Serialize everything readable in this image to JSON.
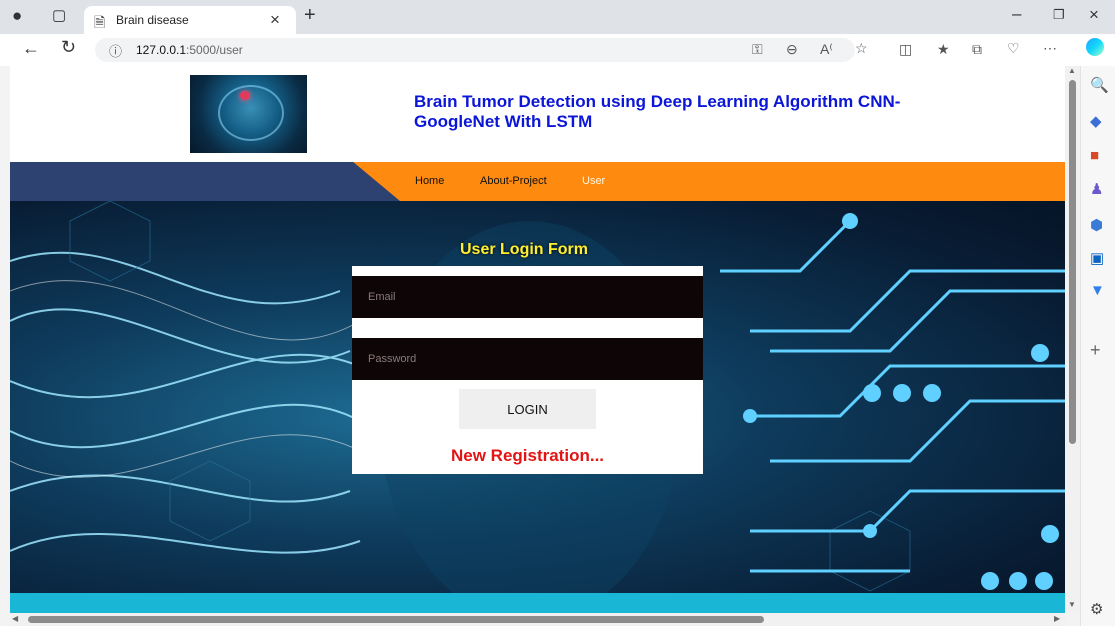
{
  "browser": {
    "tab_title": "Brain disease",
    "url_host": "127.0.0.1",
    "url_path": ":5000/user",
    "icons": [
      "profile-icon",
      "tab-actions-icon",
      "document-icon",
      "close-icon",
      "new-tab-icon",
      "minimize-icon",
      "restore-icon",
      "window-close-icon",
      "back-icon",
      "refresh-icon",
      "info-icon",
      "key-icon",
      "zoom-icon",
      "read-aloud-icon",
      "favorite-icon",
      "split-screen-icon",
      "favorites-icon",
      "collections-icon",
      "health-icon",
      "more-icon",
      "copilot-icon"
    ]
  },
  "sidebar": {
    "icons": [
      "search-icon",
      "shopping-tag-icon",
      "briefcase-icon",
      "games-icon",
      "office-icon",
      "outlook-icon",
      "send-icon",
      "add-icon",
      "settings-icon"
    ]
  },
  "site": {
    "title": "Brain Tumor Detection using Deep Learning Algorithm CNN-GoogleNet With LSTM",
    "nav": [
      {
        "label": "Home"
      },
      {
        "label": "About-Project"
      },
      {
        "label": "User",
        "active": true
      }
    ]
  },
  "login": {
    "heading": "User Login Form",
    "email_placeholder": "Email",
    "password_placeholder": "Password",
    "button_label": "LOGIN",
    "register_link": "New Registration..."
  },
  "colors": {
    "nav_orange": "#ff8a10",
    "nav_dark": "#2d4270",
    "title_blue": "#0b16d6",
    "heading_yellow": "#ffef33",
    "register_red": "#e21414",
    "band_cyan": "#19b6d6"
  }
}
